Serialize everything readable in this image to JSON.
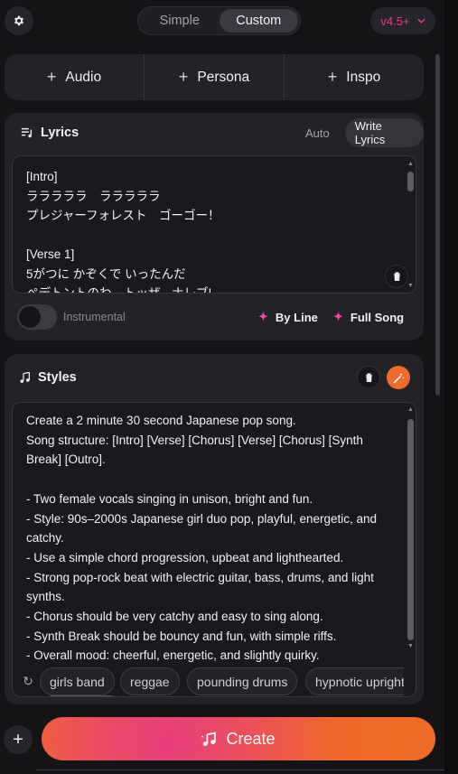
{
  "topbar": {
    "settings_icon": "gear-icon",
    "modes": [
      "Simple",
      "Custom"
    ],
    "active_mode": "Custom",
    "version_label": "v4.5+",
    "accent": "#f0338f"
  },
  "add_buttons": [
    "Audio",
    "Persona",
    "Inspo"
  ],
  "lyrics": {
    "title": "Lyrics",
    "tabs": [
      "Auto",
      "Write Lyrics"
    ],
    "active_tab": "Write Lyrics",
    "text": "[Intro]\nラララララ　ラララララ\nプレジャーフォレスト　ゴーゴー！\n\n[Verse 1]\n5がつに かぞくで いったんだ\nペデトントのわ。トッザ。ナレブ!",
    "instrumental_label": "Instrumental",
    "instrumental_on": false,
    "by_line_label": "By Line",
    "full_song_label": "Full Song"
  },
  "styles": {
    "title": "Styles",
    "text": "Create a 2 minute 30 second Japanese pop song.\nSong structure: [Intro] [Verse] [Chorus] [Verse] [Chorus] [Synth\nBreak] [Outro].\n\n- Two female vocals singing in unison, bright and fun.\n- Style: 90s–2000s Japanese girl duo pop, playful, energetic, and\ncatchy.\n- Use a simple chord progression, upbeat and lighthearted.\n- Strong pop-rock beat with electric guitar, bass, drums, and light\nsynths.\n- Chorus should be very catchy and easy to sing along.\n- Synth Break should be bouncy and fun, with simple riffs.\n- Overall mood: cheerful, energetic, and slightly quirky.",
    "tags": [
      "girls band",
      "reggae",
      "pounding drums",
      "hypnotic upright b"
    ],
    "magic_color": "#f26b2c"
  },
  "create_label": "Create"
}
